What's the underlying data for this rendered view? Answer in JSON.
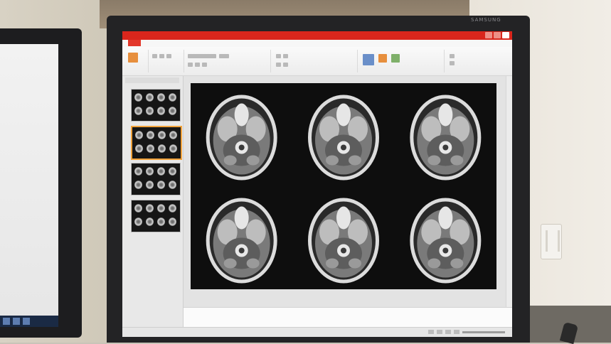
{
  "monitor": {
    "brand": "SAMSUNG"
  },
  "app": {
    "file_tab": "",
    "ribbon_tabs": [
      "",
      "",
      "",
      "",
      "",
      "",
      "",
      ""
    ]
  },
  "slide": {
    "rows": 2,
    "cols": 3
  },
  "thumbnails": {
    "count": 4,
    "selected_index": 1
  },
  "colors": {
    "title_bar": "#d9261c",
    "selection": "#f2a33b",
    "slide_background": "#0e0e0e"
  },
  "icons": {
    "window_controls": [
      "minimize-icon",
      "maximize-icon",
      "close-icon"
    ]
  }
}
